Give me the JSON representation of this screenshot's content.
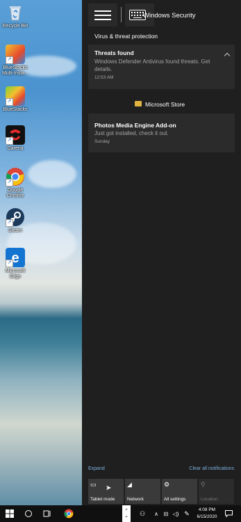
{
  "desktop": {
    "icons": [
      {
        "label": "Recycle Bin"
      },
      {
        "label": "BlueStacks Multi-Insta..."
      },
      {
        "label": "BlueStacks"
      },
      {
        "label": "Garena"
      },
      {
        "label": "Google Chrome"
      },
      {
        "label": "Steam"
      },
      {
        "label": "Microsoft Edge"
      }
    ]
  },
  "action_center": {
    "groups": [
      {
        "app": "Windows Security",
        "notifications": [
          {
            "title": "Virus & threat protection"
          },
          {
            "title": "Threats found",
            "body": "Windows Defender Antivirus found threats. Get details.",
            "time": "12:53 AM"
          }
        ]
      },
      {
        "app": "Microsoft Store",
        "notifications": [
          {
            "title": "Photos Media Engine Add-on",
            "body": "Just got installed, check it out.",
            "time": "Sunday"
          }
        ]
      }
    ],
    "expand_label": "Expand",
    "clear_label": "Clear all notifications",
    "quick_actions": [
      {
        "label": "Tablet mode",
        "icon": "tablet-mode-icon"
      },
      {
        "label": "Network",
        "icon": "network-icon"
      },
      {
        "label": "All settings",
        "icon": "settings-gear-icon"
      },
      {
        "label": "Location",
        "icon": "location-icon",
        "disabled": true
      }
    ]
  },
  "taskbar": {
    "time": "4:08 PM",
    "date": "6/15/2020"
  },
  "colors": {
    "action_center_bg": "#1f1f1f",
    "card_bg": "#2b2b2b",
    "accent_link": "#7db0e0",
    "taskbar_bg": "#101010"
  }
}
